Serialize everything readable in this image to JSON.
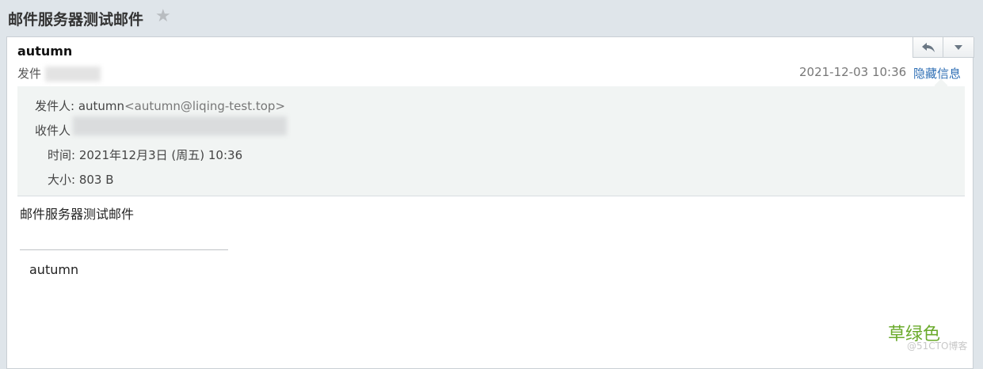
{
  "header": {
    "subject": "邮件服务器测试邮件",
    "star_icon": "star-icon"
  },
  "message": {
    "sender_name": "autumn",
    "from_short_label": "发件",
    "date": "2021-12-03 10:36",
    "hide_details_label": "隐藏信息",
    "toolbar": {
      "reply_icon": "reply-icon",
      "more_icon": "dropdown-arrow-icon"
    }
  },
  "details": {
    "from_label": "发件人:",
    "from_name": "autumn",
    "from_email": "<autumn@liqing-test.top>",
    "to_label": "收件人",
    "time_label": "时间:",
    "time_value": "2021年12月3日 (周五) 10:36",
    "size_label": "大小:",
    "size_value": "803 B"
  },
  "content": {
    "body": "邮件服务器测试邮件",
    "signature": "autumn"
  },
  "watermark": {
    "main": "草绿色",
    "sub": "@51CTO博客"
  },
  "colors": {
    "link": "#2f6fb5",
    "watermark": "#6aaa2b",
    "details_bg": "#f1f4f3"
  }
}
